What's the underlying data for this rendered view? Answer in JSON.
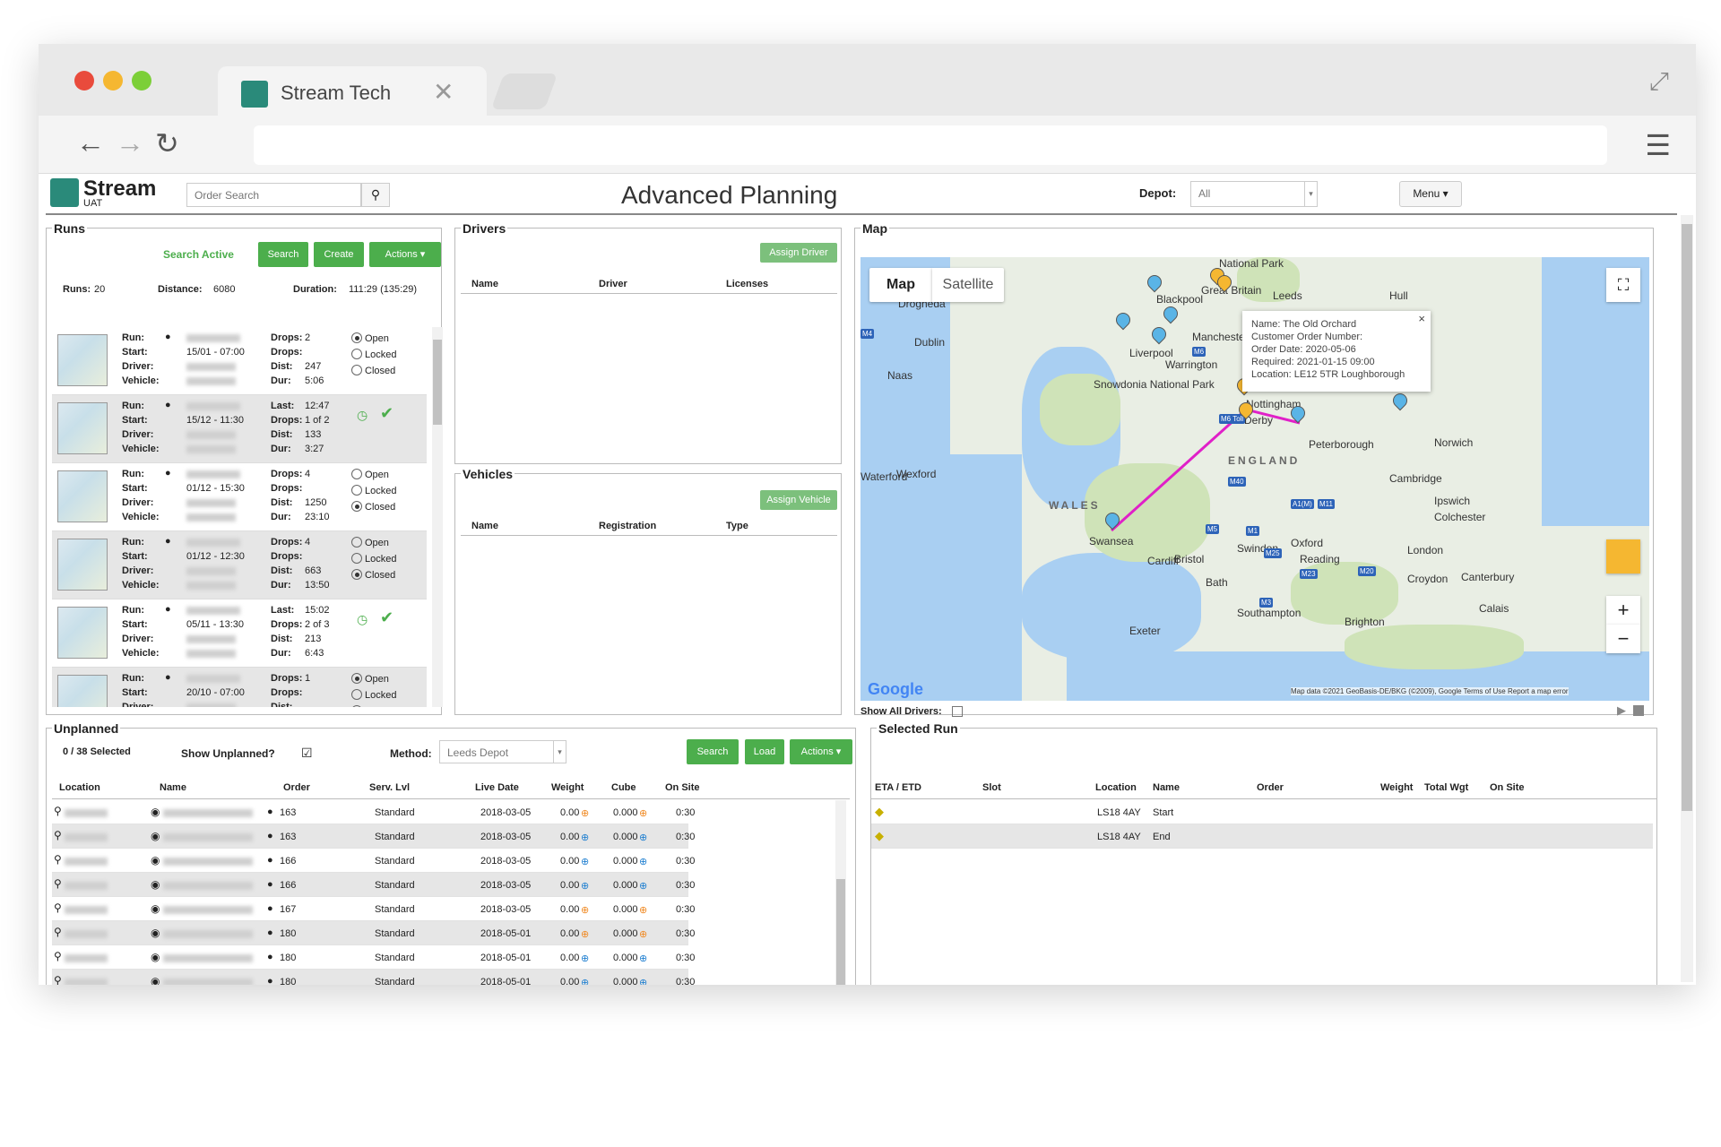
{
  "browser": {
    "tab_title": "Stream Tech",
    "tab_close": "✕",
    "back": "←",
    "forward": "→",
    "reload": "↻",
    "menu": "☰",
    "expand": "⤢"
  },
  "app": {
    "logo_text": "Stream",
    "logo_sub": "UAT",
    "order_search_placeholder": "Order Search",
    "search_icon": "⚲",
    "page_title": "Advanced Planning",
    "depot_label": "Depot:",
    "depot_value": "All",
    "menu_label": "Menu ▾"
  },
  "runs": {
    "title": "Runs",
    "search_active": "Search Active",
    "search_btn": "Search",
    "create_btn": "Create",
    "actions_btn": "Actions ▾",
    "runs_label": "Runs:",
    "runs_value": "20",
    "distance_label": "Distance:",
    "distance_value": "6080",
    "duration_label": "Duration:",
    "duration_value": "111:29 (135:29)",
    "labels": {
      "run": "Run:",
      "start": "Start:",
      "driver": "Driver:",
      "vehicle": "Vehicle:",
      "drops": "Drops:",
      "last": "Last:",
      "dist": "Dist:",
      "dur": "Dur:"
    },
    "status": {
      "open": "Open",
      "locked": "Locked",
      "closed": "Closed"
    },
    "items": [
      {
        "start": "15/01 - 07:00",
        "first": "Drops:",
        "first_val": "2",
        "drops": "",
        "dist": "247",
        "dur": "5:06",
        "mode": "radio",
        "selected": "open"
      },
      {
        "start": "15/12 - 11:30",
        "first": "Last:",
        "first_val": "12:47",
        "drops": "1 of 2",
        "dist": "133",
        "dur": "3:27",
        "mode": "done"
      },
      {
        "start": "01/12 - 15:30",
        "first": "Drops:",
        "first_val": "4",
        "drops": "",
        "dist": "1250",
        "dur": "23:10",
        "mode": "radio",
        "selected": "closed"
      },
      {
        "start": "01/12 - 12:30",
        "first": "Drops:",
        "first_val": "4",
        "drops": "",
        "dist": "663",
        "dur": "13:50",
        "mode": "radio",
        "selected": "closed"
      },
      {
        "start": "05/11 - 13:30",
        "first": "Last:",
        "first_val": "15:02",
        "drops": "2 of 3",
        "dist": "213",
        "dur": "6:43",
        "mode": "done"
      },
      {
        "start": "20/10 - 07:00",
        "first": "Drops:",
        "first_val": "1",
        "drops": "",
        "dist": "",
        "dur": "",
        "mode": "radio",
        "selected": "open"
      }
    ]
  },
  "drivers": {
    "title": "Drivers",
    "assign_btn": "Assign Driver",
    "columns": [
      "Name",
      "Driver",
      "Licenses"
    ]
  },
  "vehicles": {
    "title": "Vehicles",
    "assign_btn": "Assign Vehicle",
    "columns": [
      "Name",
      "Registration",
      "Type"
    ]
  },
  "map": {
    "title": "Map",
    "map_tab": "Map",
    "satellite_tab": "Satellite",
    "fullscreen": "⛶",
    "zoom_in": "+",
    "zoom_out": "−",
    "google": "Google",
    "attribution": "Map data ©2021 GeoBasis-DE/BKG (©2009), Google   Terms of Use   Report a map error",
    "show_all_drivers": "Show All Drivers:",
    "infowindow": {
      "close": "×",
      "name": "Name: The Old Orchard",
      "customer_order": "Customer Order Number:",
      "order_date": "Order Date: 2020-05-06",
      "required": "Required: 2021-01-15 09:00",
      "location": "Location: LE12 5TR Loughborough"
    },
    "places": [
      "National Park",
      "Great Britain",
      "Blackpool",
      "Leeds",
      "Hull",
      "Dublin",
      "Drogheda",
      "Naas",
      "Liverpool",
      "Manchester",
      "Warrington",
      "Snowdonia National Park",
      "Nottingham",
      "Derby",
      "Peterborough",
      "Norwich",
      "ENGLAND",
      "WALES",
      "Wexford",
      "Waterford",
      "Cambridge",
      "Ipswich",
      "Colchester",
      "Oxford",
      "Swansea",
      "Cardiff",
      "Bristol",
      "Swindon",
      "Reading",
      "London",
      "Bath",
      "Croydon",
      "Canterbury",
      "Southampton",
      "Brighton",
      "Exeter",
      "Calais"
    ],
    "roads": [
      "M4",
      "M6",
      "M6 Toll",
      "M5",
      "M40",
      "M1",
      "A1(M)",
      "M11",
      "M25",
      "M3",
      "M23",
      "M20"
    ]
  },
  "unplanned": {
    "title": "Unplanned",
    "selected": "0 / 38 Selected",
    "show_unplanned": "Show Unplanned?",
    "checkbox": "☑",
    "method_label": "Method:",
    "method_value": "Leeds Depot",
    "search_btn": "Search",
    "load_btn": "Load",
    "actions_btn": "Actions ▾",
    "columns": [
      "Location",
      "Name",
      "Order",
      "Serv. Lvl",
      "Live Date",
      "Weight",
      "Cube",
      "On Site"
    ],
    "rows": [
      {
        "order": "163",
        "serv": "Standard",
        "date": "2018-03-05",
        "weight": "0.00",
        "cube": "0.000",
        "onsite": "0:30",
        "flag": "or"
      },
      {
        "order": "163",
        "serv": "Standard",
        "date": "2018-03-05",
        "weight": "0.00",
        "cube": "0.000",
        "onsite": "0:30",
        "flag": "bl"
      },
      {
        "order": "166",
        "serv": "Standard",
        "date": "2018-03-05",
        "weight": "0.00",
        "cube": "0.000",
        "onsite": "0:30",
        "flag": "bl"
      },
      {
        "order": "166",
        "serv": "Standard",
        "date": "2018-03-05",
        "weight": "0.00",
        "cube": "0.000",
        "onsite": "0:30",
        "flag": "bl"
      },
      {
        "order": "167",
        "serv": "Standard",
        "date": "2018-03-05",
        "weight": "0.00",
        "cube": "0.000",
        "onsite": "0:30",
        "flag": "or"
      },
      {
        "order": "180",
        "serv": "Standard",
        "date": "2018-05-01",
        "weight": "0.00",
        "cube": "0.000",
        "onsite": "0:30",
        "flag": "or"
      },
      {
        "order": "180",
        "serv": "Standard",
        "date": "2018-05-01",
        "weight": "0.00",
        "cube": "0.000",
        "onsite": "0:30",
        "flag": "bl"
      },
      {
        "order": "180",
        "serv": "Standard",
        "date": "2018-05-01",
        "weight": "0.00",
        "cube": "0.000",
        "onsite": "0:30",
        "flag": "bl"
      }
    ]
  },
  "selected_run": {
    "title": "Selected Run",
    "columns": [
      "ETA / ETD",
      "Slot",
      "Location",
      "Name",
      "Order",
      "Weight",
      "Total Wgt",
      "On Site"
    ],
    "rows": [
      {
        "location": "LS18 4AY",
        "name": "Start"
      },
      {
        "location": "LS18 4AY",
        "name": "End"
      }
    ]
  },
  "colors": {
    "accent": "#4cae4c",
    "brand": "#2a8a7a",
    "route": "#e020c8",
    "pin_blue": "#5ab4e6",
    "pin_yellow": "#f5b731"
  }
}
